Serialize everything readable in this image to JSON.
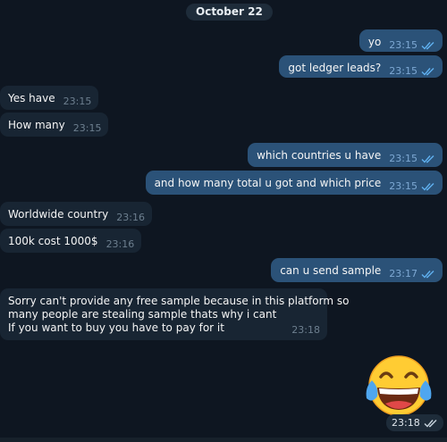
{
  "date_separator": "October 22",
  "messages": [
    {
      "text": "yo",
      "time": "23:15"
    },
    {
      "text": "got ledger leads?",
      "time": "23:15"
    },
    {
      "text": "Yes have",
      "time": "23:15"
    },
    {
      "text": "How many",
      "time": "23:15"
    },
    {
      "text": "which countries u have",
      "time": "23:15"
    },
    {
      "text": "and how many total u got and which price",
      "time": "23:15"
    },
    {
      "text": "Worldwide country",
      "time": "23:16"
    },
    {
      "text": "100k cost 1000$",
      "time": "23:16"
    },
    {
      "text": "can u send sample",
      "time": "23:17"
    },
    {
      "lines": [
        "Sorry can't provide any free sample because in this platform so",
        "many people are stealing sample thats why i cant",
        "If you want to buy you have to pay for it"
      ],
      "time": "23:18"
    },
    {
      "emoji": "face-with-tears-of-joy",
      "time": "23:18"
    }
  ],
  "colors": {
    "background": "#0e1621",
    "outgoing_bubble": "#2b5278",
    "incoming_bubble": "#182533",
    "read_check": "#5fb0ef"
  }
}
